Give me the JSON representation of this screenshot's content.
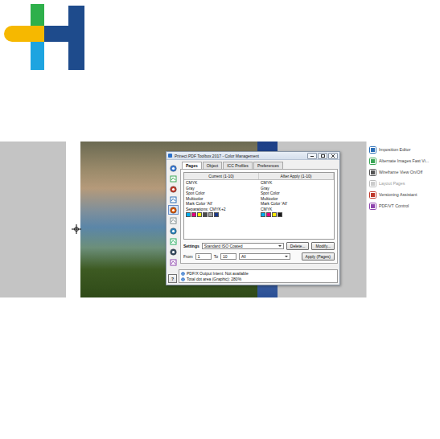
{
  "dialog": {
    "title": "Prinect PDF Toolbox 2017 - Color Management",
    "toolbar": [
      {
        "selected": false
      },
      {
        "selected": false
      },
      {
        "selected": false
      },
      {
        "selected": false
      },
      {
        "selected": true
      },
      {
        "selected": false
      },
      {
        "selected": false
      },
      {
        "selected": false
      },
      {
        "selected": false
      },
      {
        "selected": false
      }
    ],
    "tabs": [
      {
        "label": "Pages",
        "selected": true
      },
      {
        "label": "Object",
        "selected": false
      },
      {
        "label": "ICC Profiles",
        "selected": false
      },
      {
        "label": "Preferences",
        "selected": false
      }
    ],
    "table": {
      "columns": [
        "Current (1-10)",
        "After Apply (1-10)"
      ],
      "rows": [
        {
          "current": "CMYK",
          "after": "CMYK"
        },
        {
          "current": "Gray",
          "after": "Gray"
        },
        {
          "current": "Spot Color",
          "after": "Spot Color"
        },
        {
          "current": "Multicolor",
          "after": "Multicolor"
        },
        {
          "current": "Mark Color 'All'",
          "after": "Mark Color 'All'"
        },
        {
          "current": "Separations: CMYK+2",
          "after": "CMYK"
        }
      ],
      "swatches_current": [
        {
          "color": "#00aeef"
        },
        {
          "color": "#e6007e"
        },
        {
          "color": "#ffed00"
        },
        {
          "color": "#4a4a4a"
        },
        {
          "color": "#9a9a9a"
        },
        {
          "color": "#1b3a8c"
        }
      ],
      "swatches_after": [
        {
          "color": "#00aeef"
        },
        {
          "color": "#e6007e"
        },
        {
          "color": "#ffed00"
        },
        {
          "color": "#1a1a1a"
        }
      ]
    },
    "settings": {
      "label": "Settings",
      "value": "Standard ISO Coated",
      "buttons": [
        "Delete...",
        "Modify..."
      ]
    },
    "range": {
      "from_label": "From",
      "from": "1",
      "to_label": "To",
      "to": "10",
      "pages": "All",
      "apply": "Apply (Pages)"
    },
    "info": [
      "PDF/X Output Intent: Not available",
      "Total dot area (Graphic): 280%"
    ],
    "help": "?"
  },
  "side_panel": {
    "items": [
      {
        "label": "Imposition Editor",
        "disabled": false
      },
      {
        "label": "Alternate Images Fast Vi...",
        "disabled": false
      },
      {
        "label": "Wireframe View On/Off",
        "disabled": false
      },
      {
        "label": "Layout Pages",
        "disabled": true
      },
      {
        "label": "Versioning Assistant",
        "disabled": false
      },
      {
        "label": "PDF/VT Control",
        "disabled": false
      }
    ]
  }
}
